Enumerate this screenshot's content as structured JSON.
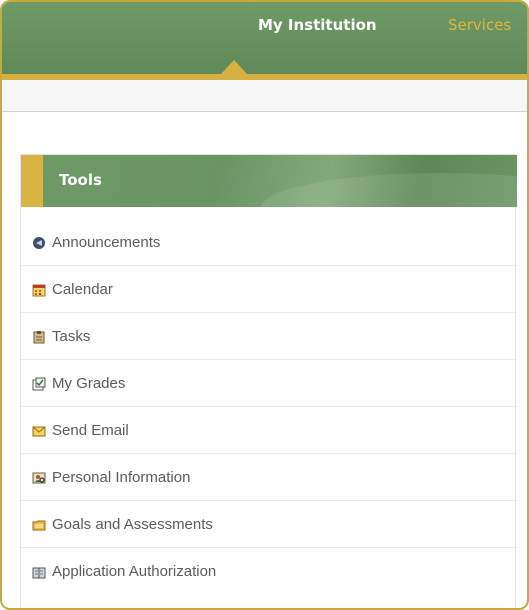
{
  "nav": {
    "tabs": [
      {
        "label": "My Institution",
        "active": true
      },
      {
        "label": "Services",
        "active": false
      }
    ],
    "active_color": "#ffffff",
    "inactive_color": "#e3b53a",
    "bar_color": "#6a9563",
    "accent_color": "#d6b142"
  },
  "tools_panel": {
    "title": "Tools",
    "items": [
      {
        "label": "Announcements",
        "icon": "megaphone-icon"
      },
      {
        "label": "Calendar",
        "icon": "calendar-icon"
      },
      {
        "label": "Tasks",
        "icon": "clipboard-icon"
      },
      {
        "label": "My Grades",
        "icon": "grades-icon"
      },
      {
        "label": "Send Email",
        "icon": "envelope-icon"
      },
      {
        "label": "Personal Information",
        "icon": "personal-info-icon"
      },
      {
        "label": "Goals and Assessments",
        "icon": "folder-icon"
      },
      {
        "label": "Application Authorization",
        "icon": "book-icon"
      }
    ]
  }
}
